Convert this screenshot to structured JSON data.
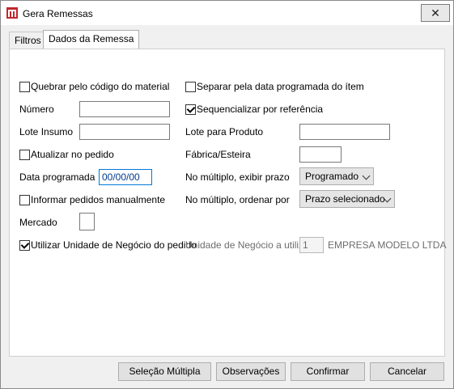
{
  "window": {
    "title": "Gera Remessas",
    "close_glyph": "✕"
  },
  "tabs": [
    "Filtros",
    "Dados da Remessa"
  ],
  "form": {
    "quebrar": {
      "label": "Quebrar pelo código do material",
      "checked": false
    },
    "separar": {
      "label": "Separar pela data programada do ítem",
      "checked": false
    },
    "numero_label": "Número",
    "numero_value": "",
    "sequencializar": {
      "label": "Sequencializar por referência",
      "checked": true
    },
    "lote_insumo_label": "Lote Insumo",
    "lote_insumo_value": "",
    "lote_produto_label": "Lote para Produto",
    "lote_produto_value": "",
    "atualizar": {
      "label": "Atualizar no pedido",
      "checked": false
    },
    "fabrica_label": "Fábrica/Esteira",
    "fabrica_value": "",
    "data_programada_label": "Data programada",
    "data_programada_value": "00/00/00",
    "exibir_prazo_label": "No múltiplo, exibir prazo",
    "exibir_prazo_value": "Programado",
    "informar": {
      "label": "Informar pedidos manualmente",
      "checked": false
    },
    "ordenar_label": "No múltiplo, ordenar por",
    "ordenar_value": "Prazo selecionado",
    "mercado_label": "Mercado",
    "mercado_value": "",
    "utilizar_un": {
      "label": "Utilizar Unidade de Negócio do pedido",
      "checked": true
    },
    "un_utilizar_label": "Unidade de Negócio a utilizar",
    "un_code": "1",
    "un_name": "EMPRESA MODELO LTDA"
  },
  "buttons": {
    "selecao_multipla": "Seleção Múltipla",
    "observacoes": "Observações",
    "confirmar": "Confirmar",
    "cancelar": "Cancelar"
  },
  "colors": {
    "accent": "#0078d7",
    "icon_red": "#c0282d"
  }
}
